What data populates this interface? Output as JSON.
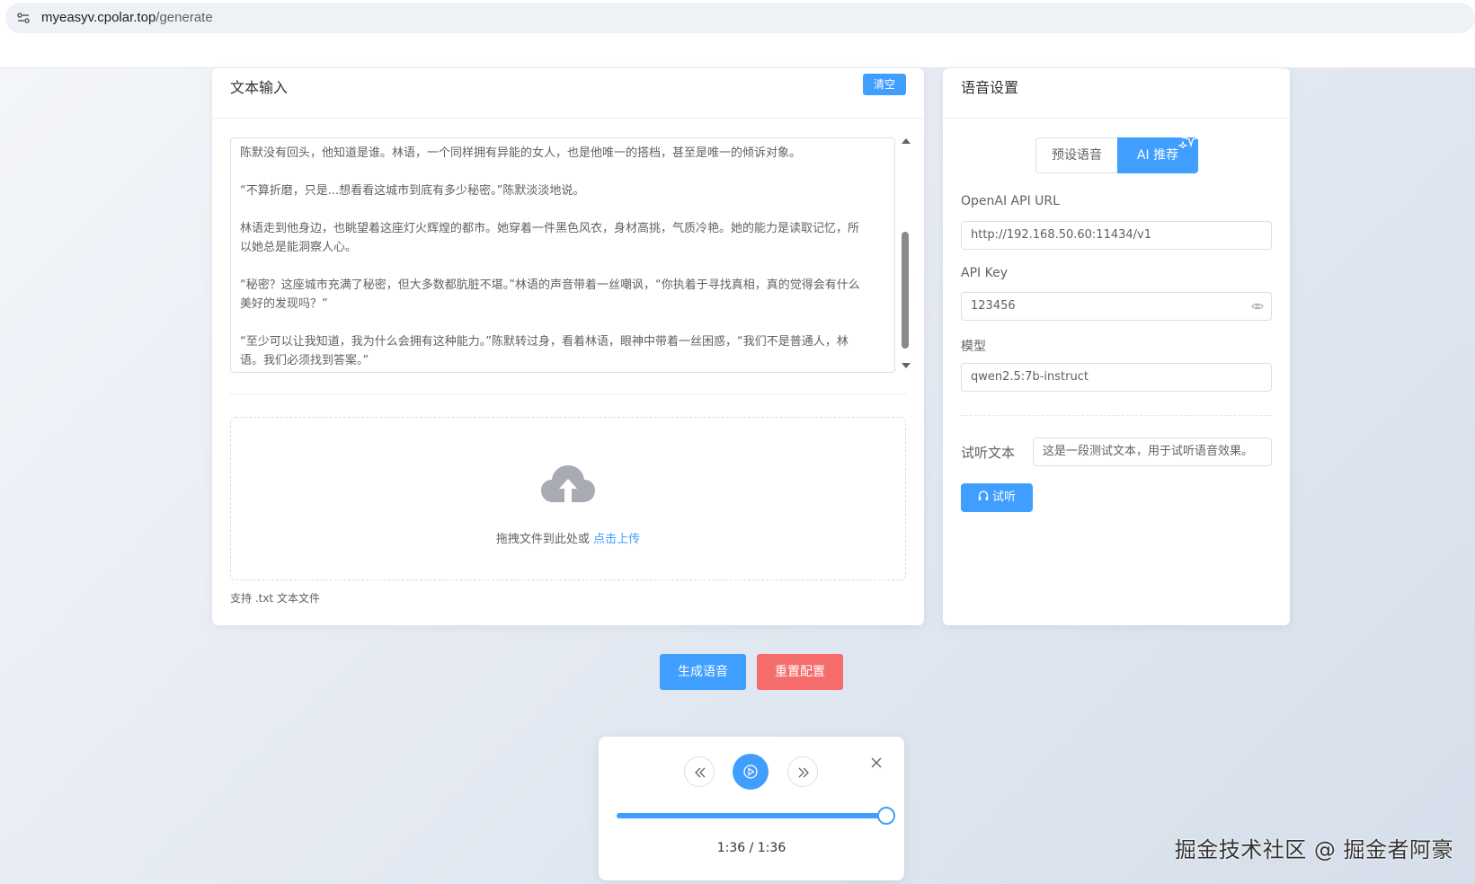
{
  "browser": {
    "url_domain": "myeasyv.cpolar.top",
    "url_path": "/generate"
  },
  "text_input": {
    "title": "文本输入",
    "clear_label": "清空",
    "paragraphs": [
      "陈默没有回头，他知道是谁。林语，一个同样拥有异能的女人，也是他唯一的搭档，甚至是唯一的倾诉对象。",
      "“不算折磨，只是...想看看这城市到底有多少秘密。”陈默淡淡地说。",
      "林语走到他身边，也眺望着这座灯火辉煌的都市。她穿着一件黑色风衣，身材高挑，气质冷艳。她的能力是读取记忆，所以她总是能洞察人心。",
      "“秘密？这座城市充满了秘密，但大多数都肮脏不堪。”林语的声音带着一丝嘲讽，“你执着于寻找真相，真的觉得会有什么美好的发现吗？”",
      "“至少可以让我知道，我为什么会拥有这种能力。”陈默转过身，看着林语，眼神中带着一丝困惑，“我们不是普通人，林语。我们必须找到答案。”"
    ],
    "upload_prompt": "拖拽文件到此处或 ",
    "upload_link": "点击上传",
    "upload_tip": "支持 .txt 文本文件"
  },
  "voice_settings": {
    "title": "语音设置",
    "tab_preset": "预设语音",
    "tab_ai": "AI 推荐",
    "api_url_label": "OpenAI API URL",
    "api_url_value": "http://192.168.50.60:11434/v1",
    "api_key_label": "API Key",
    "api_key_value": "123456",
    "model_label": "模型",
    "model_value": "qwen2.5:7b-instruct",
    "preview_label": "试听文本",
    "preview_value": "这是一段测试文本，用于试听语音效果。",
    "listen_label": "试听"
  },
  "actions": {
    "generate_label": "生成语音",
    "reset_label": "重置配置"
  },
  "player": {
    "time": "1:36 / 1:36",
    "progress": 1.0
  },
  "watermark": "掘金技术社区 @ 掘金者阿豪",
  "colors": {
    "primary": "#409eff",
    "danger": "#f56c6c"
  }
}
